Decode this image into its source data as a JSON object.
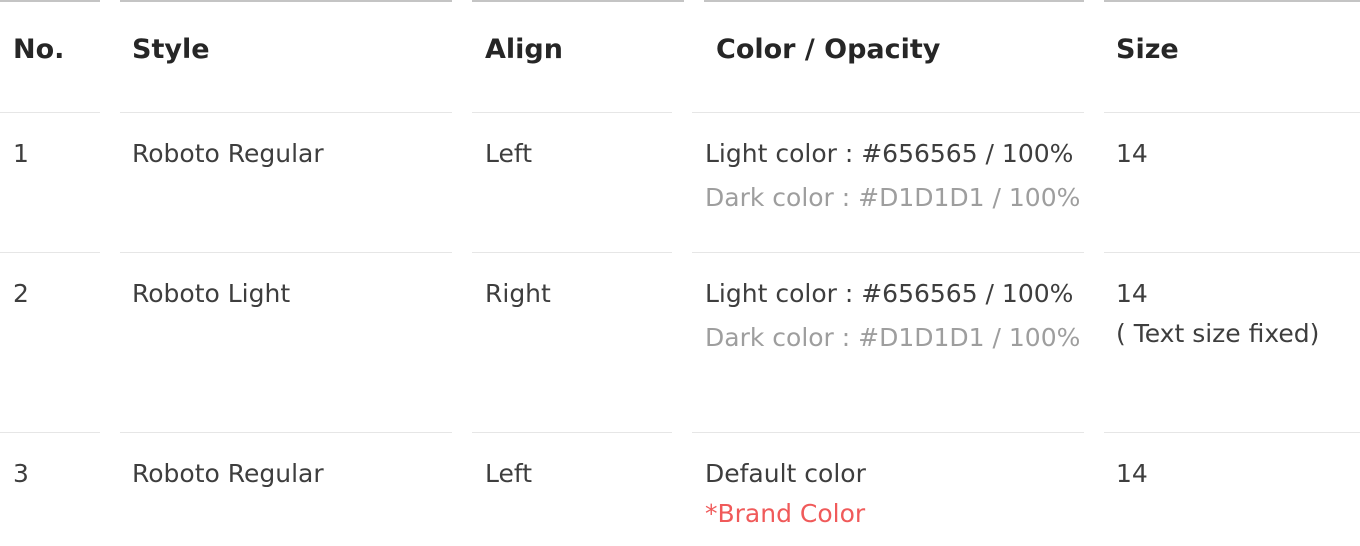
{
  "table": {
    "headers": {
      "no": "No.",
      "style": "Style",
      "align": "Align",
      "color": "Color / Opacity",
      "size": "Size"
    },
    "rows": [
      {
        "no": "1",
        "style": "Roboto Regular",
        "align": "Left",
        "color_primary": "Light color : #656565 / 100%",
        "color_secondary": "Dark color : #D1D1D1 / 100%",
        "size": "14",
        "size_note": ""
      },
      {
        "no": "2",
        "style": "Roboto Light",
        "align": "Right",
        "color_primary": "Light color : #656565 / 100%",
        "color_secondary": "Dark color : #D1D1D1 / 100%",
        "size": "14",
        "size_note": "( Text size fixed)"
      },
      {
        "no": "3",
        "style": "Roboto Regular",
        "align": "Left",
        "color_primary": "Default color",
        "color_secondary": "*Brand Color",
        "size": "14",
        "size_note": ""
      }
    ]
  },
  "colors": {
    "text": "#3e3e3e",
    "muted": "#9e9e9e",
    "brand": "#f05a5a",
    "rule": "#e6e6e6",
    "top_rule": "#c4c4c4"
  }
}
